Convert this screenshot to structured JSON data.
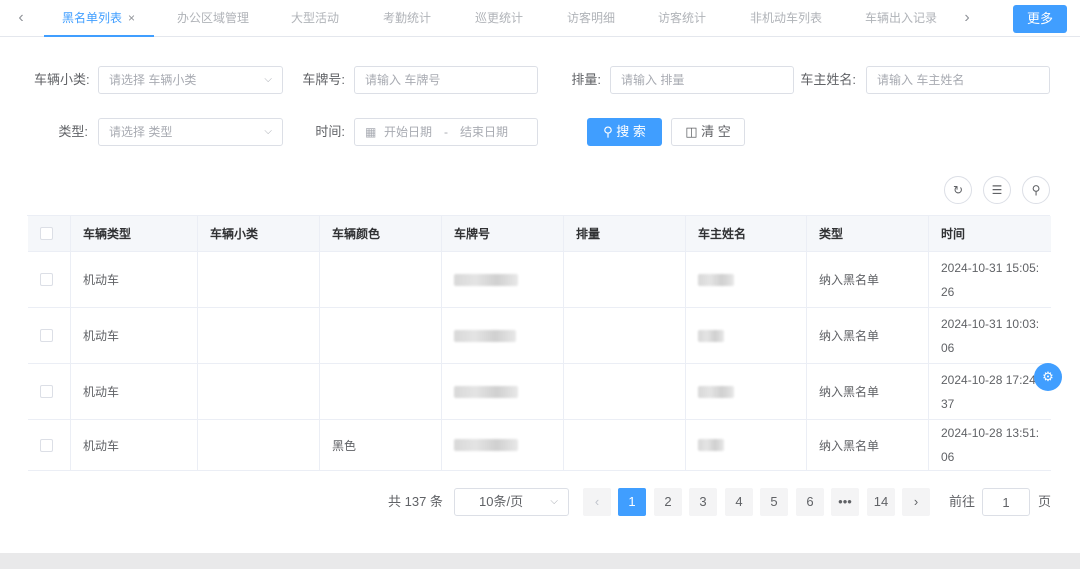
{
  "tabs": {
    "items": [
      {
        "label": "黑名单列表",
        "active": true
      },
      {
        "label": "办公区域管理"
      },
      {
        "label": "大型活动"
      },
      {
        "label": "考勤统计"
      },
      {
        "label": "巡更统计"
      },
      {
        "label": "访客明细"
      },
      {
        "label": "访客统计"
      },
      {
        "label": "非机动车列表"
      },
      {
        "label": "车辆出入记录"
      }
    ],
    "close_icon": "×",
    "prev_icon": "‹",
    "next_icon": "›",
    "more_label": "更多"
  },
  "filters": {
    "vehicle_subtype": {
      "label": "车辆小类:",
      "placeholder": "请选择 车辆小类"
    },
    "plate": {
      "label": "车牌号:",
      "placeholder": "请输入 车牌号"
    },
    "displacement": {
      "label": "排量:",
      "placeholder": "请输入 排量"
    },
    "owner": {
      "label": "车主姓名:",
      "placeholder": "请输入 车主姓名"
    },
    "type": {
      "label": "类型:",
      "placeholder": "请选择 类型"
    },
    "time": {
      "label": "时间:",
      "start_placeholder": "开始日期",
      "separator": "-",
      "end_placeholder": "结束日期"
    },
    "search_label": "搜 索",
    "clear_label": "清 空"
  },
  "table": {
    "headers": [
      "车辆类型",
      "车辆小类",
      "车辆颜色",
      "车牌号",
      "排量",
      "车主姓名",
      "类型",
      "时间"
    ],
    "rows": [
      {
        "vehicle_type": "机动车",
        "subtype": "",
        "color": "",
        "displacement": "",
        "list_type": "纳入黑名单",
        "time": "2024-10-31 15:05:26"
      },
      {
        "vehicle_type": "机动车",
        "subtype": "",
        "color": "",
        "displacement": "",
        "list_type": "纳入黑名单",
        "time": "2024-10-31 10:03:06"
      },
      {
        "vehicle_type": "机动车",
        "subtype": "",
        "color": "",
        "displacement": "",
        "list_type": "纳入黑名单",
        "time": "2024-10-28 17:24:37"
      },
      {
        "vehicle_type": "机动车",
        "subtype": "",
        "color": "黑色",
        "displacement": "",
        "list_type": "纳入黑名单",
        "time": "2024-10-28 13:51:06"
      }
    ]
  },
  "pagination": {
    "total_text": "共 137 条",
    "page_size": "10条/页",
    "pages": [
      "1",
      "2",
      "3",
      "4",
      "5",
      "6",
      "•••",
      "14"
    ],
    "current_page": "1",
    "goto_prefix": "前往",
    "goto_value": "1",
    "goto_suffix": "页"
  },
  "colors": {
    "primary": "#409eff",
    "border": "#dcdfe6"
  }
}
